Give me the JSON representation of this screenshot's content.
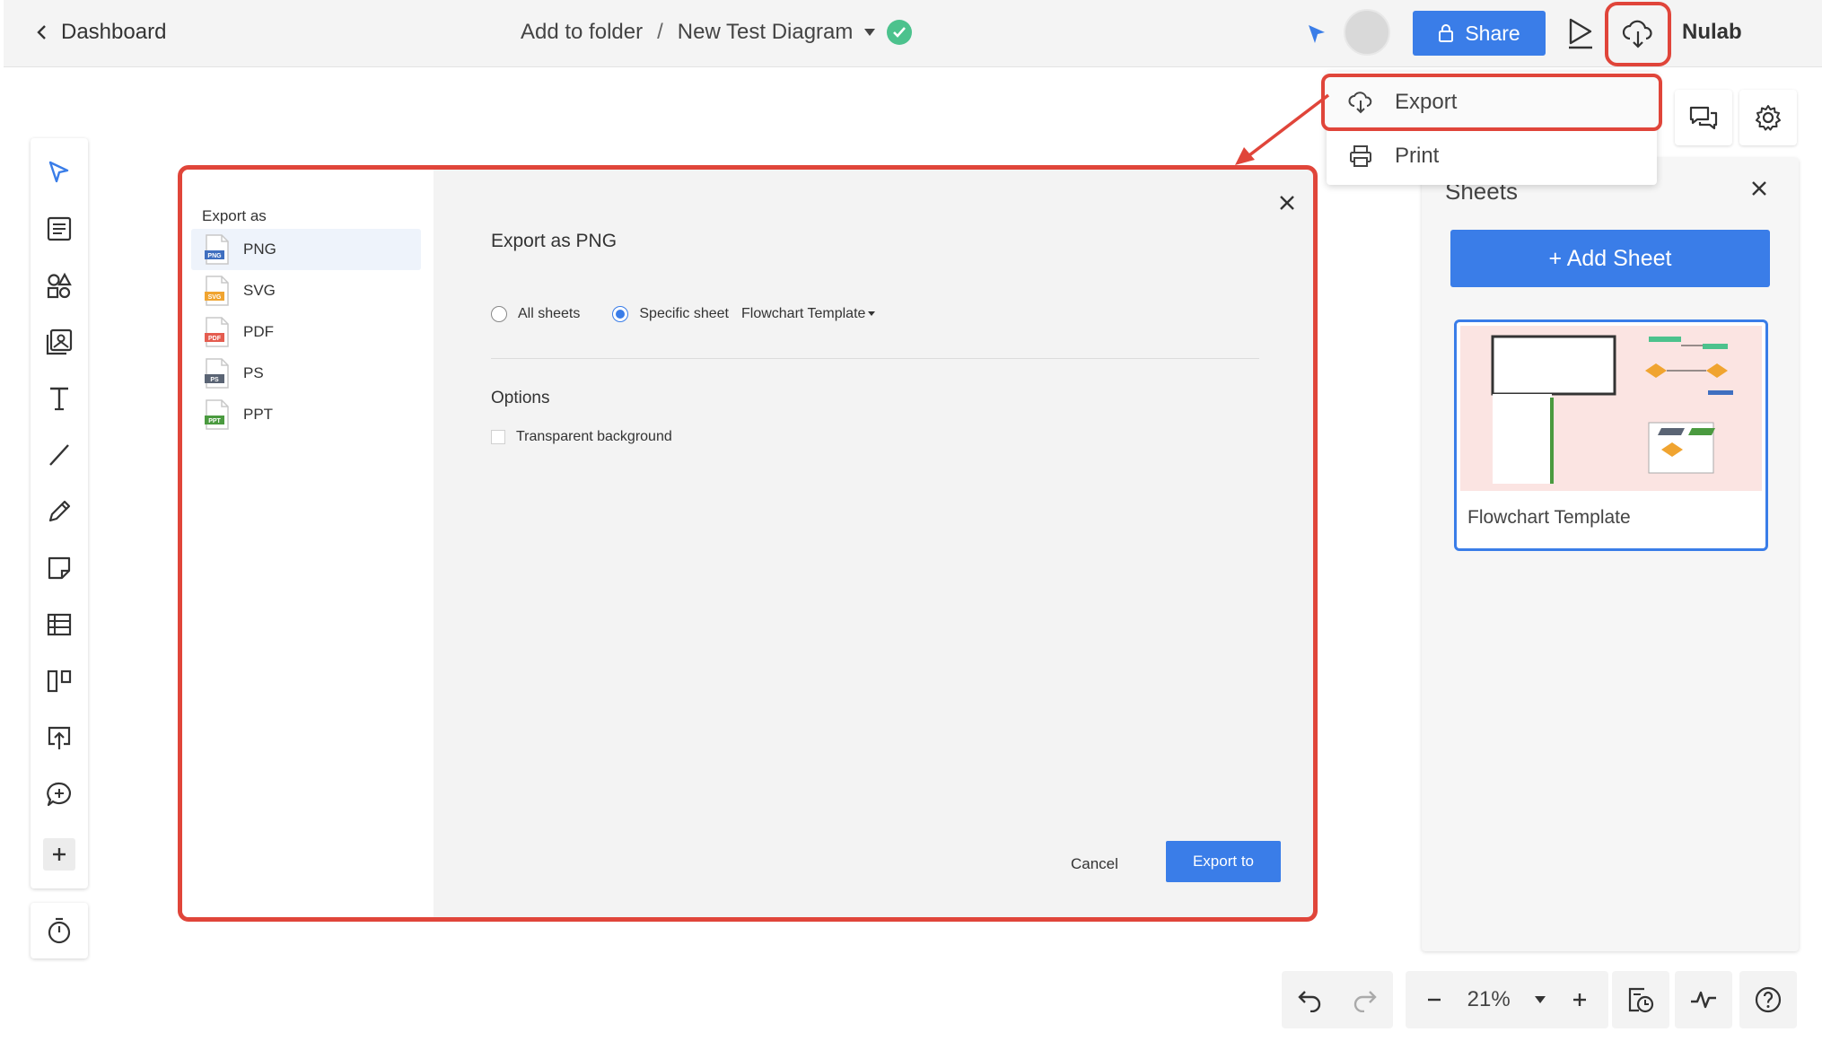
{
  "header": {
    "back_label": "Dashboard",
    "folder_label": "Add to folder",
    "separator": "/",
    "diagram_title": "New Test Diagram",
    "share_label": "Share",
    "brand": "Nulab"
  },
  "export_menu": {
    "export_label": "Export",
    "print_label": "Print"
  },
  "sheets_panel": {
    "title": "Sheets",
    "add_label": "+ Add Sheet",
    "sheets": [
      {
        "name": "Flowchart Template"
      }
    ]
  },
  "export_dialog": {
    "sidebar_title": "Export as",
    "formats": [
      {
        "label": "PNG",
        "badge": "PNG",
        "color": "#3f6fc0",
        "active": true
      },
      {
        "label": "SVG",
        "badge": "SVG",
        "color": "#f0a430",
        "active": false
      },
      {
        "label": "PDF",
        "badge": "PDF",
        "color": "#e45c4f",
        "active": false
      },
      {
        "label": "PS",
        "badge": "PS",
        "color": "#5a6474",
        "active": false
      },
      {
        "label": "PPT",
        "badge": "PPT",
        "color": "#4a9a3f",
        "active": false
      }
    ],
    "title": "Export as PNG",
    "radio_all": "All sheets",
    "radio_specific": "Specific sheet",
    "selected_sheet": "Flowchart Template",
    "options_title": "Options",
    "transparent_label": "Transparent background",
    "cancel_label": "Cancel",
    "export_label": "Export to"
  },
  "zoom": {
    "level": "21%"
  },
  "colors": {
    "accent": "#3a7de8",
    "highlight": "#e0453a",
    "success": "#4cc28d"
  }
}
